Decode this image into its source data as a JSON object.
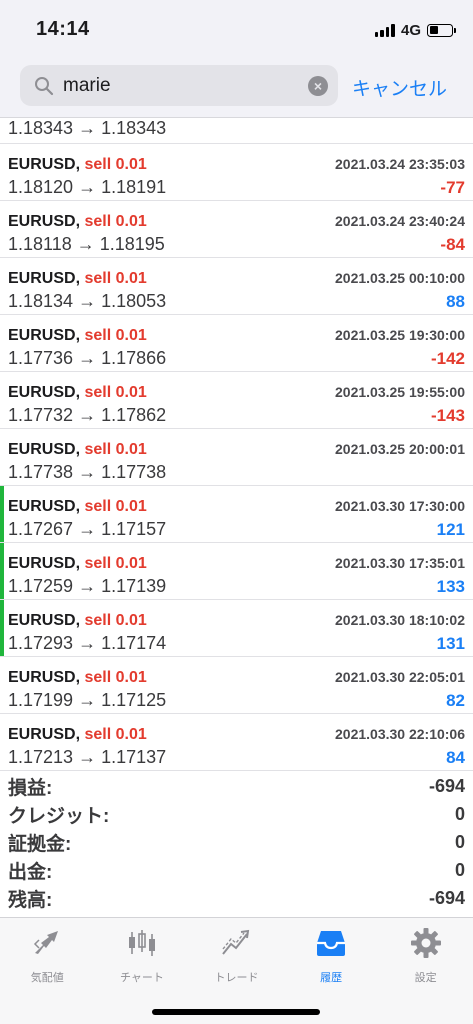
{
  "status": {
    "time": "14:14",
    "network": "4G"
  },
  "search": {
    "value": "marie",
    "cancel_label": "キャンセル"
  },
  "partial_row": {
    "prices": "1.18343 → 1.18343"
  },
  "trades": [
    {
      "symbol": "EURUSD,",
      "side": "sell 0.01",
      "datetime": "2021.03.24 23:35:03",
      "prices": "1.18120 → 1.18191",
      "profit": "-77",
      "sign": "neg",
      "marked": false
    },
    {
      "symbol": "EURUSD,",
      "side": "sell 0.01",
      "datetime": "2021.03.24 23:40:24",
      "prices": "1.18118 → 1.18195",
      "profit": "-84",
      "sign": "neg",
      "marked": false
    },
    {
      "symbol": "EURUSD,",
      "side": "sell 0.01",
      "datetime": "2021.03.25 00:10:00",
      "prices": "1.18134 → 1.18053",
      "profit": "88",
      "sign": "pos",
      "marked": false
    },
    {
      "symbol": "EURUSD,",
      "side": "sell 0.01",
      "datetime": "2021.03.25 19:30:00",
      "prices": "1.17736 → 1.17866",
      "profit": "-142",
      "sign": "neg",
      "marked": false
    },
    {
      "symbol": "EURUSD,",
      "side": "sell 0.01",
      "datetime": "2021.03.25 19:55:00",
      "prices": "1.17732 → 1.17862",
      "profit": "-143",
      "sign": "neg",
      "marked": false
    },
    {
      "symbol": "EURUSD,",
      "side": "sell 0.01",
      "datetime": "2021.03.25 20:00:01",
      "prices": "1.17738 → 1.17738",
      "profit": "",
      "sign": "pos",
      "marked": false
    },
    {
      "symbol": "EURUSD,",
      "side": "sell 0.01",
      "datetime": "2021.03.30 17:30:00",
      "prices": "1.17267 → 1.17157",
      "profit": "121",
      "sign": "pos",
      "marked": true
    },
    {
      "symbol": "EURUSD,",
      "side": "sell 0.01",
      "datetime": "2021.03.30 17:35:01",
      "prices": "1.17259 → 1.17139",
      "profit": "133",
      "sign": "pos",
      "marked": true
    },
    {
      "symbol": "EURUSD,",
      "side": "sell 0.01",
      "datetime": "2021.03.30 18:10:02",
      "prices": "1.17293 → 1.17174",
      "profit": "131",
      "sign": "pos",
      "marked": true
    },
    {
      "symbol": "EURUSD,",
      "side": "sell 0.01",
      "datetime": "2021.03.30 22:05:01",
      "prices": "1.17199 → 1.17125",
      "profit": "82",
      "sign": "pos",
      "marked": false
    },
    {
      "symbol": "EURUSD,",
      "side": "sell 0.01",
      "datetime": "2021.03.30 22:10:06",
      "prices": "1.17213 → 1.17137",
      "profit": "84",
      "sign": "pos",
      "marked": false
    }
  ],
  "summary": [
    {
      "label": "損益:",
      "value": "-694"
    },
    {
      "label": "クレジット:",
      "value": "0"
    },
    {
      "label": "証拠金:",
      "value": "0"
    },
    {
      "label": "出金:",
      "value": "0"
    },
    {
      "label": "残高:",
      "value": "-694"
    }
  ],
  "tabs": [
    {
      "label": "気配値",
      "icon": "quotes-icon",
      "active": false
    },
    {
      "label": "チャート",
      "icon": "chart-icon",
      "active": false
    },
    {
      "label": "トレード",
      "icon": "trade-icon",
      "active": false
    },
    {
      "label": "履歴",
      "icon": "history-icon",
      "active": true
    },
    {
      "label": "設定",
      "icon": "settings-icon",
      "active": false
    }
  ],
  "colors": {
    "accent": "#1a7ff5",
    "negative": "#e33b2e",
    "marker": "#20b63c"
  }
}
